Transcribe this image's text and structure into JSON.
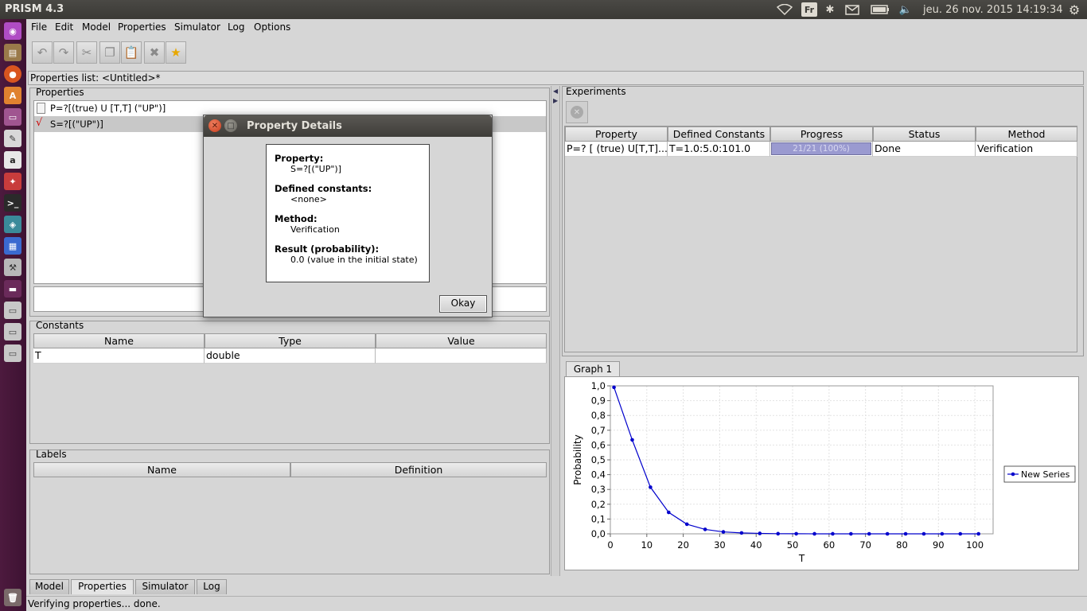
{
  "topbar": {
    "app_title": "PRISM 4.3",
    "keyboard_layout": "Fr",
    "datetime": "jeu. 26 nov. 2015 14:19:34"
  },
  "menu": {
    "items": [
      "File",
      "Edit",
      "Model",
      "Properties",
      "Simulator",
      "Log",
      "Options"
    ]
  },
  "properties_list_title": "Properties list: <Untitled>*",
  "properties_panel": {
    "title": "Properties",
    "items": [
      "P=?[(true) U [T,T] (\"UP\")]",
      "S=?[(\"UP\")]"
    ]
  },
  "constants_panel": {
    "title": "Constants",
    "headers": [
      "Name",
      "Type",
      "Value"
    ],
    "rows": [
      [
        "T",
        "double",
        ""
      ]
    ]
  },
  "labels_panel": {
    "title": "Labels",
    "headers": [
      "Name",
      "Definition"
    ]
  },
  "experiments_panel": {
    "title": "Experiments",
    "headers": [
      "Property",
      "Defined Constants",
      "Progress",
      "Status",
      "Method"
    ],
    "row": {
      "property": "P=? [ (true) U[T,T]...",
      "constants": "T=1.0:5.0:101.0",
      "progress": "21/21 (100%)",
      "progress_fraction": 1.0,
      "status": "Done",
      "method": "Verification"
    }
  },
  "graph_tab": "Graph 1",
  "dialog": {
    "title": "Property Details",
    "property_label": "Property:",
    "property_value": "S=?[(\"UP\")]",
    "constants_label": "Defined constants:",
    "constants_value": "<none>",
    "method_label": "Method:",
    "method_value": "Verification",
    "result_label": "Result (probability):",
    "result_value": "0.0 (value in the initial state)",
    "ok_label": "Okay"
  },
  "bottom_tabs": [
    "Model",
    "Properties",
    "Simulator",
    "Log"
  ],
  "status_text": "Verifying properties... done.",
  "colors": {
    "series": "#0000cc",
    "progress_fill": "#9a9ad0",
    "launcher": "#4d1a3e"
  },
  "chart_data": {
    "type": "line",
    "xlabel": "T",
    "ylabel": "Probability",
    "xlim": [
      0,
      105
    ],
    "ylim": [
      0,
      1.0
    ],
    "xticks": [
      "0",
      "10",
      "20",
      "30",
      "40",
      "50",
      "60",
      "70",
      "80",
      "90",
      "100"
    ],
    "yticks": [
      "0,0",
      "0,1",
      "0,2",
      "0,3",
      "0,4",
      "0,5",
      "0,6",
      "0,7",
      "0,8",
      "0,9",
      "1,0"
    ],
    "legend_position": "right",
    "grid": true,
    "series": [
      {
        "name": "New Series",
        "x": [
          1,
          6,
          11,
          16,
          21,
          26,
          31,
          36,
          41,
          46,
          51,
          56,
          61,
          66,
          71,
          76,
          81,
          86,
          91,
          96,
          101
        ],
        "y": [
          0.99,
          0.635,
          0.315,
          0.145,
          0.065,
          0.03,
          0.013,
          0.006,
          0.003,
          0.001,
          0.0005,
          0.0002,
          0.0001,
          0.0,
          0.0,
          0.0,
          0.0,
          0.0,
          0.0,
          0.0,
          0.0
        ]
      }
    ]
  }
}
